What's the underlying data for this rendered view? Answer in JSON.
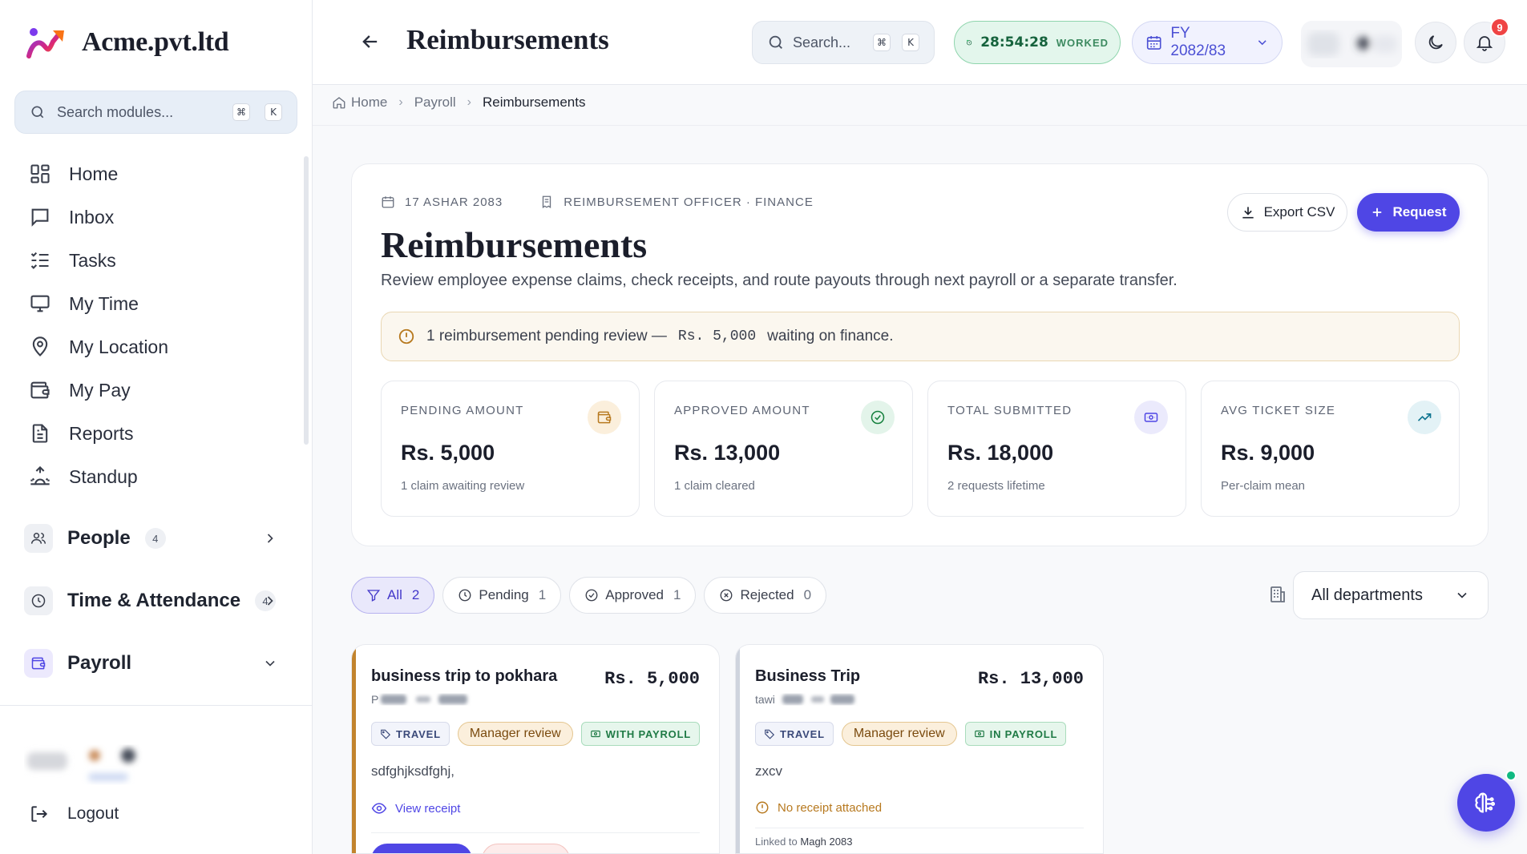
{
  "brand": {
    "name": "Acme.pvt.ltd"
  },
  "sidebar": {
    "search_placeholder": "Search modules...",
    "shortcut": [
      "⌘",
      "K"
    ],
    "items": [
      {
        "label": "Home",
        "icon": "grid-icon"
      },
      {
        "label": "Inbox",
        "icon": "chat-icon"
      },
      {
        "label": "Tasks",
        "icon": "checklist-icon"
      },
      {
        "label": "My Time",
        "icon": "monitor-icon"
      },
      {
        "label": "My Location",
        "icon": "location-pin-icon"
      },
      {
        "label": "My Pay",
        "icon": "wallet-icon"
      },
      {
        "label": "Reports",
        "icon": "document-icon"
      },
      {
        "label": "Standup",
        "icon": "sunrise-icon"
      }
    ],
    "groups": [
      {
        "label": "People",
        "count": "4",
        "icon": "users-icon"
      },
      {
        "label": "Time & Attendance",
        "count": "4",
        "icon": "clock-icon"
      },
      {
        "label": "Payroll",
        "icon": "wallet-icon"
      }
    ],
    "logout": "Logout"
  },
  "header": {
    "title": "Reimbursements",
    "search_placeholder": "Search...",
    "shortcut": [
      "⌘",
      "K"
    ],
    "worked_time": "28:54:28",
    "worked_label": "WORKED",
    "fiscal_year": "FY 2082/83",
    "notifications": "9"
  },
  "breadcrumb": {
    "home": "Home",
    "parent": "Payroll",
    "current": "Reimbursements"
  },
  "card": {
    "date": "17 ASHAR 2083",
    "role": "REIMBURSEMENT OFFICER · FINANCE",
    "title": "Reimbursements",
    "description": "Review employee expense claims, check receipts, and route payouts through next payroll or a separate transfer.",
    "export_label": "Export CSV",
    "request_label": "Request",
    "alert": {
      "count_text": "1 reimbursement pending review —",
      "amount": "Rs. 5,000",
      "suffix": "waiting on finance."
    },
    "stats": [
      {
        "label": "PENDING AMOUNT",
        "value": "Rs. 5,000",
        "sub": "1 claim awaiting review",
        "icon": "wallet-icon",
        "color": "#b7791f"
      },
      {
        "label": "APPROVED AMOUNT",
        "value": "Rs. 13,000",
        "sub": "1 claim cleared",
        "icon": "check-circle-icon",
        "color": "#15803d"
      },
      {
        "label": "TOTAL SUBMITTED",
        "value": "Rs. 18,000",
        "sub": "2 requests lifetime",
        "icon": "banknote-icon",
        "color": "#4f46e5"
      },
      {
        "label": "AVG TICKET SIZE",
        "value": "Rs. 9,000",
        "sub": "Per-claim mean",
        "icon": "trending-up-icon",
        "color": "#0e7490"
      }
    ]
  },
  "filters": [
    {
      "label": "All",
      "count": "2",
      "active": true
    },
    {
      "label": "Pending",
      "count": "1"
    },
    {
      "label": "Approved",
      "count": "1"
    },
    {
      "label": "Rejected",
      "count": "0"
    }
  ],
  "department_select": "All departments",
  "claims": [
    {
      "title": "business trip to pokhara",
      "amount": "Rs. 5,000",
      "employee_initial": "P",
      "category": "TRAVEL",
      "status": "Manager review",
      "payout": "WITH PAYROLL",
      "note": "sdfghjksdfghj,",
      "receipt": "View receipt"
    },
    {
      "title": "Business Trip",
      "amount": "Rs. 13,000",
      "employee_initial": "tawi",
      "category": "TRAVEL",
      "status": "Manager review",
      "payout": "IN PAYROLL",
      "note": "zxcv",
      "receipt": "No receipt attached",
      "linked_label": "Linked to",
      "linked_period": "Magh 2083"
    }
  ]
}
